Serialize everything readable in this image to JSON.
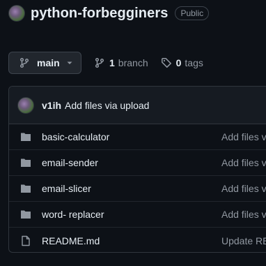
{
  "repo": {
    "name": "python-forbegginers",
    "visibility": "Public"
  },
  "toolbar": {
    "branch": "main",
    "branch_count": "1",
    "branch_label": "branch",
    "tag_count": "0",
    "tag_label": "tags"
  },
  "commit": {
    "author": "v1ih",
    "message": "Add files via upload"
  },
  "files": [
    {
      "name": "basic-calculator",
      "type": "folder",
      "commit": "Add files v"
    },
    {
      "name": "email-sender",
      "type": "folder",
      "commit": "Add files v"
    },
    {
      "name": "email-slicer",
      "type": "folder",
      "commit": "Add files v"
    },
    {
      "name": "word- replacer",
      "type": "folder",
      "commit": "Add files v"
    },
    {
      "name": "README.md",
      "type": "file",
      "commit": "Update RE"
    }
  ],
  "colors": {
    "background": "#0d1117",
    "text": "#e6edf3",
    "muted": "#9198a1",
    "border": "#30363d",
    "folder_icon": "#9198a1"
  }
}
